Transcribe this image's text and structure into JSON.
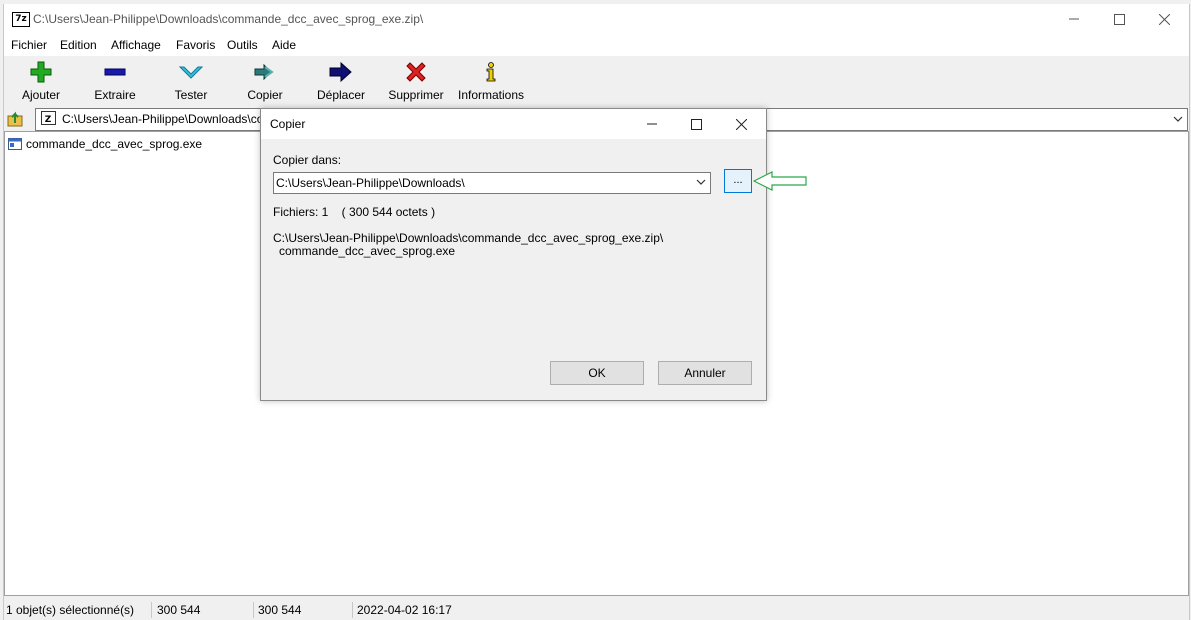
{
  "window": {
    "title": "C:\\Users\\Jean-Philippe\\Downloads\\commande_dcc_avec_sprog_exe.zip\\",
    "app_icon_text": "7z"
  },
  "menu": [
    "Fichier",
    "Edition",
    "Affichage",
    "Favoris",
    "Outils",
    "Aide"
  ],
  "toolbar": [
    {
      "label": "Ajouter",
      "icon": "plus-icon",
      "color": "#22aa22"
    },
    {
      "label": "Extraire",
      "icon": "minus-icon",
      "color": "#1a1aaa"
    },
    {
      "label": "Tester",
      "icon": "check-chevron-icon",
      "color": "#2aa8c8"
    },
    {
      "label": "Copier",
      "icon": "double-arrow-icon",
      "color": "#2a7a7a"
    },
    {
      "label": "Déplacer",
      "icon": "arrow-right-icon",
      "color": "#101070"
    },
    {
      "label": "Supprimer",
      "icon": "x-icon",
      "color": "#dd2222"
    },
    {
      "label": "Informations",
      "icon": "info-icon",
      "color": "#c8a800"
    }
  ],
  "address": {
    "value": "C:\\Users\\Jean-Philippe\\Downloads\\co"
  },
  "files": [
    {
      "name": "commande_dcc_avec_sprog.exe"
    }
  ],
  "status": {
    "selected": "1 objet(s) sélectionné(s)",
    "size": "300 544",
    "packed": "300 544",
    "modified": "2022-04-02 16:17"
  },
  "dialog": {
    "title": "Copier",
    "dest_label": "Copier dans:",
    "dest_value": "C:\\Users\\Jean-Philippe\\Downloads\\",
    "browse_label": "...",
    "files_info": "Fichiers: 1    ( 300 544 octets )",
    "source_path": "C:\\Users\\Jean-Philippe\\Downloads\\commande_dcc_avec_sprog_exe.zip\\",
    "source_file": "commande_dcc_avec_sprog.exe",
    "ok_label": "OK",
    "cancel_label": "Annuler"
  },
  "colors": {
    "annotation_arrow": "#2aa84a",
    "browse_border": "#0078d7"
  }
}
